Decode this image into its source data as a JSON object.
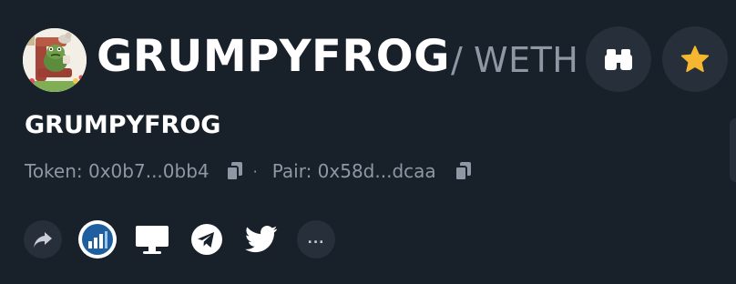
{
  "token": {
    "title": "GRUMPYFROG",
    "pair_separator": "/",
    "quote_symbol": "WETH",
    "name": "GRUMPYFROG"
  },
  "addresses": {
    "token_text": "Token: 0x0b7...0bb4",
    "dot": "·",
    "pair_text": "Pair: 0x58d...dcaa"
  },
  "actions": {
    "watch_icon": "binoculars-icon",
    "favorite_icon": "star-icon"
  },
  "social": {
    "more_label": "..."
  },
  "colors": {
    "background": "#18202a",
    "button_bg": "#262f3a",
    "muted_text": "#8e97a4",
    "star": "#f5b730",
    "chart_blue": "#2a6bb0"
  }
}
